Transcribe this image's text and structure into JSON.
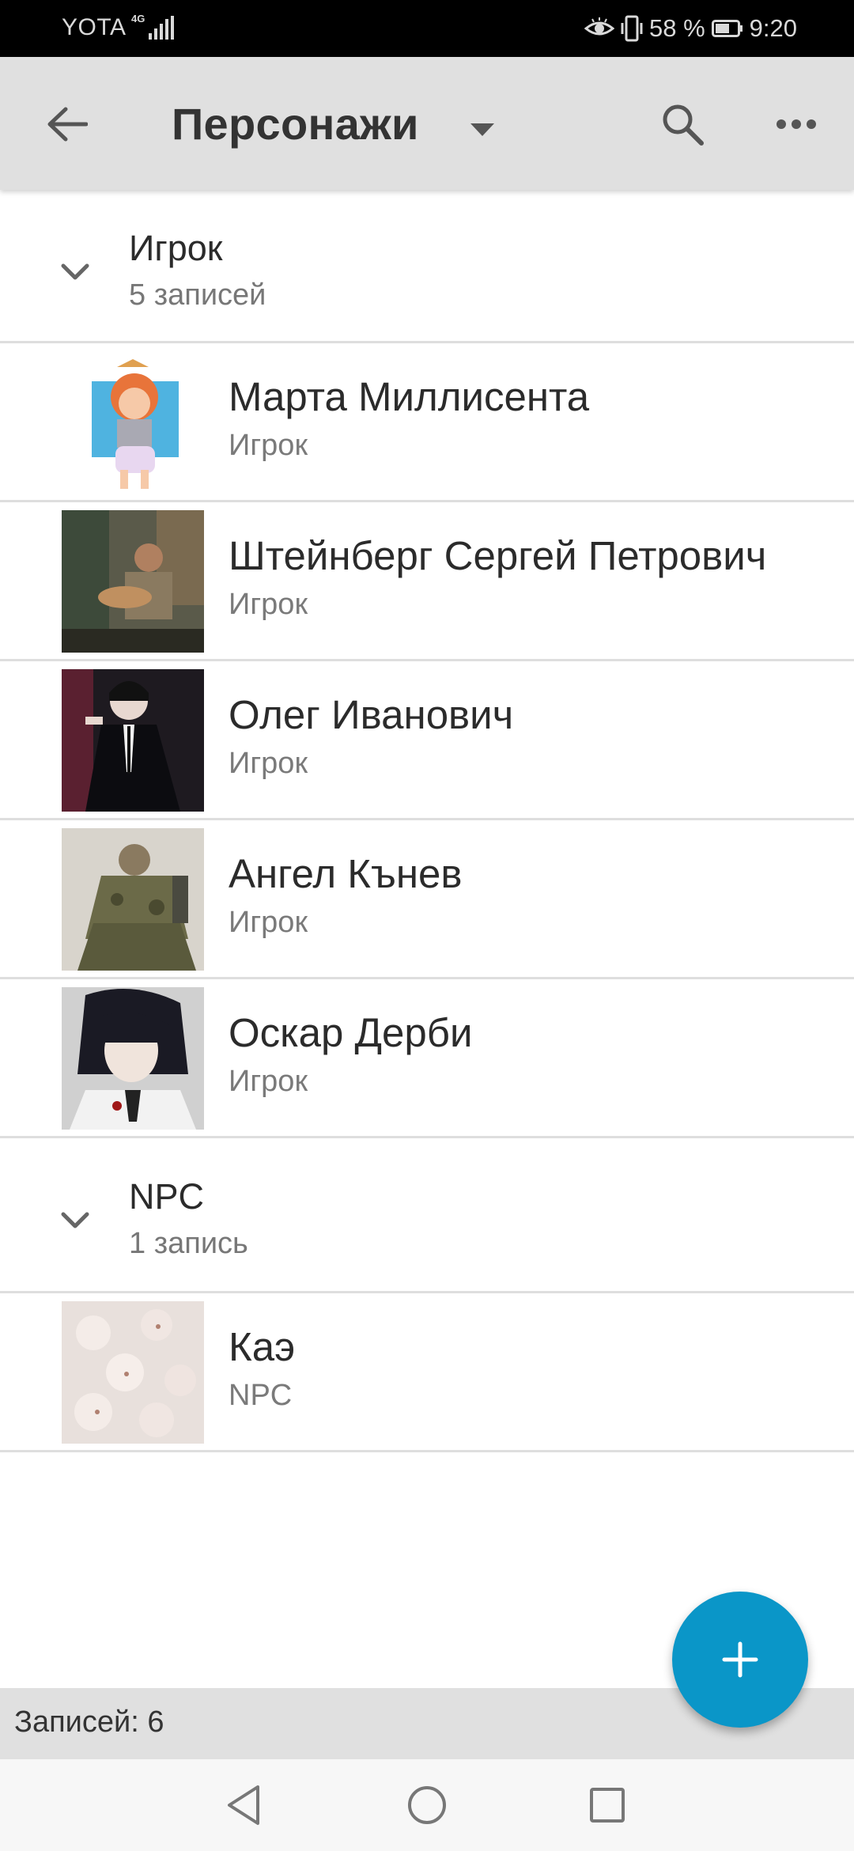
{
  "status_bar": {
    "carrier": "YOTA",
    "network": "4G",
    "battery": "58 %",
    "time": "9:20"
  },
  "app_bar": {
    "title": "Персонажи"
  },
  "groups": [
    {
      "title": "Игрок",
      "count": "5 записей",
      "items": [
        {
          "name": "Марта Миллисента",
          "role": "Игрок"
        },
        {
          "name": "Штейнберг Сергей Петрович",
          "role": "Игрок"
        },
        {
          "name": "Олег Иванович",
          "role": "Игрок"
        },
        {
          "name": "Ангел Кънев",
          "role": "Игрок"
        },
        {
          "name": "Оскар Дерби",
          "role": "Игрок"
        }
      ]
    },
    {
      "title": "NPC",
      "count": "1 запись",
      "items": [
        {
          "name": "Каэ",
          "role": "NPC"
        }
      ]
    }
  ],
  "summary": {
    "text": "Записей: 6"
  },
  "colors": {
    "accent": "#0a96c8",
    "app_bar": "#e0e0e0"
  }
}
